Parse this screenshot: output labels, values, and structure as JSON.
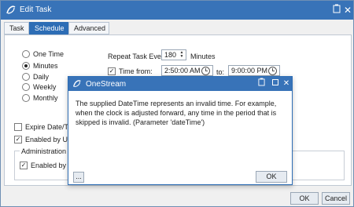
{
  "window": {
    "title": "Edit Task",
    "close_glyph": "✕",
    "copy_icon": "clipboard-icon"
  },
  "tabs": [
    {
      "label": "Task",
      "active": false
    },
    {
      "label": "Schedule",
      "active": true
    },
    {
      "label": "Advanced",
      "active": false
    }
  ],
  "schedule": {
    "frequency_options": [
      {
        "label": "One Time",
        "checked": false
      },
      {
        "label": "Minutes",
        "checked": true
      },
      {
        "label": "Daily",
        "checked": false
      },
      {
        "label": "Weekly",
        "checked": false
      },
      {
        "label": "Monthly",
        "checked": false
      }
    ],
    "repeat_label": "Repeat Task Every:",
    "repeat_value": "180",
    "repeat_unit": "Minutes",
    "time_from_label": "Time from:",
    "time_from_checked": true,
    "time_from_value": "2:50:00 AM",
    "to_label": "to:",
    "time_to_value": "9:00:00 PM",
    "expire_label": "Expire Date/Tim",
    "expire_checked": false,
    "enabled_user_label": "Enabled by Use",
    "enabled_user_checked": true,
    "admin_group_label": "Administration",
    "enabled_manager_label": "Enabled by M",
    "enabled_manager_checked": true
  },
  "footer": {
    "ok_label": "OK",
    "cancel_label": "Cancel"
  },
  "dialog": {
    "title": "OneStream",
    "message": "The supplied DateTime represents an invalid time.  For example, when the clock is adjusted forward, any time in the period that is skipped is invalid. (Parameter 'dateTime')",
    "details_label": "...",
    "ok_label": "OK"
  },
  "colors": {
    "title_bar": "#3873b8",
    "tab_active": "#2d6db5"
  }
}
